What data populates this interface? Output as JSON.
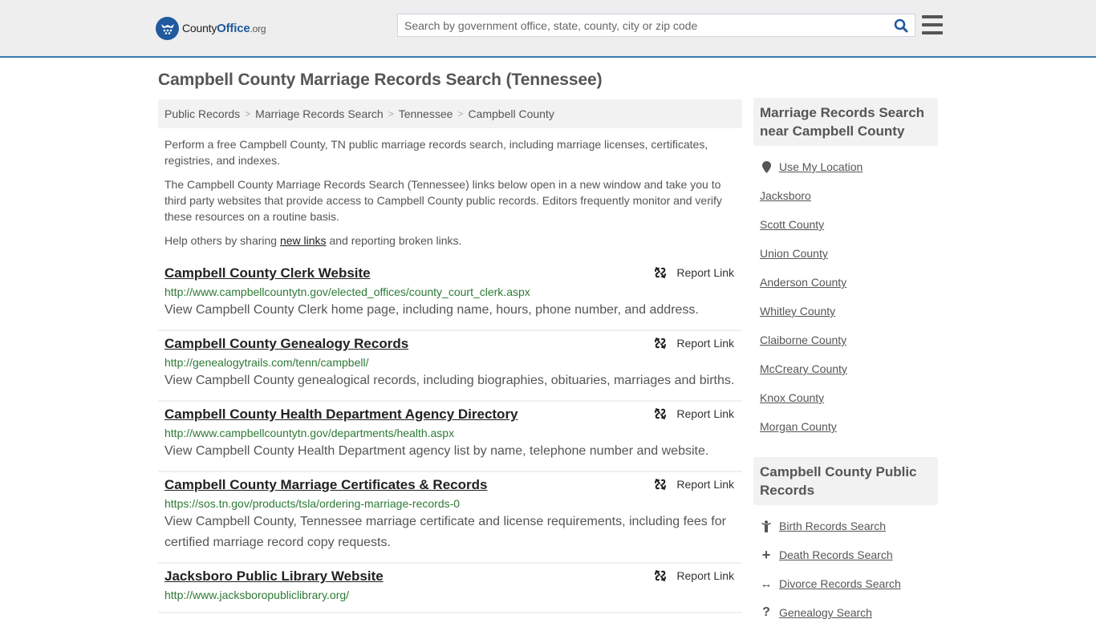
{
  "header": {
    "logo_county": "County",
    "logo_office": "Office",
    "logo_org": ".org",
    "search_placeholder": "Search by government office, state, county, city or zip code",
    "search_value": "",
    "brand_color": "#1f5a9e",
    "accent_border_color": "#3a7bb0"
  },
  "page": {
    "title": "Campbell County Marriage Records Search (Tennessee)"
  },
  "breadcrumb": [
    {
      "label": "Public Records"
    },
    {
      "label": "Marriage Records Search"
    },
    {
      "label": "Tennessee"
    },
    {
      "label": "Campbell County"
    }
  ],
  "breadcrumb_separator": ">",
  "intro": {
    "p1": "Perform a free Campbell County, TN public marriage records search, including marriage licenses, certificates, registries, and indexes.",
    "p2": "The Campbell County Marriage Records Search (Tennessee) links below open in a new window and take you to third party websites that provide access to Campbell County public records. Editors frequently monitor and verify these resources on a routine basis.",
    "p3_before": "Help others by sharing ",
    "p3_link": "new links",
    "p3_after": " and reporting broken links."
  },
  "report_label": "Report Link",
  "results": [
    {
      "title": "Campbell County Clerk Website",
      "url": "http://www.campbellcountytn.gov/elected_offices/county_court_clerk.aspx",
      "description": "View Campbell County Clerk home page, including name, hours, phone number, and address."
    },
    {
      "title": "Campbell County Genealogy Records",
      "url": "http://genealogytrails.com/tenn/campbell/",
      "description": "View Campbell County genealogical records, including biographies, obituaries, marriages and births."
    },
    {
      "title": "Campbell County Health Department Agency Directory",
      "url": "http://www.campbellcountytn.gov/departments/health.aspx",
      "description": "View Campbell County Health Department agency list by name, telephone number and website."
    },
    {
      "title": "Campbell County Marriage Certificates & Records",
      "url": "https://sos.tn.gov/products/tsla/ordering-marriage-records-0",
      "description": "View Campbell County, Tennessee marriage certificate and license requirements, including fees for certified marriage record copy requests."
    },
    {
      "title": "Jacksboro Public Library Website",
      "url": "http://www.jacksboropubliclibrary.org/",
      "description": ""
    }
  ],
  "sidebar": {
    "nearby_heading": "Marriage Records Search near Campbell County",
    "use_location": "Use My Location",
    "nearby": [
      {
        "label": "Jacksboro"
      },
      {
        "label": "Scott County"
      },
      {
        "label": "Union County"
      },
      {
        "label": "Anderson County"
      },
      {
        "label": "Whitley County"
      },
      {
        "label": "Claiborne County"
      },
      {
        "label": "McCreary County"
      },
      {
        "label": "Knox County"
      },
      {
        "label": "Morgan County"
      }
    ],
    "public_heading": "Campbell County Public Records",
    "public_records": [
      {
        "label": "Birth Records Search",
        "icon": "child-icon",
        "glyph": "†"
      },
      {
        "label": "Death Records Search",
        "icon": "cross-icon",
        "glyph": "+"
      },
      {
        "label": "Divorce Records Search",
        "icon": "arrows-horizontal-icon",
        "glyph": "↔"
      },
      {
        "label": "Genealogy Search",
        "icon": "question-icon",
        "glyph": "?"
      }
    ]
  }
}
